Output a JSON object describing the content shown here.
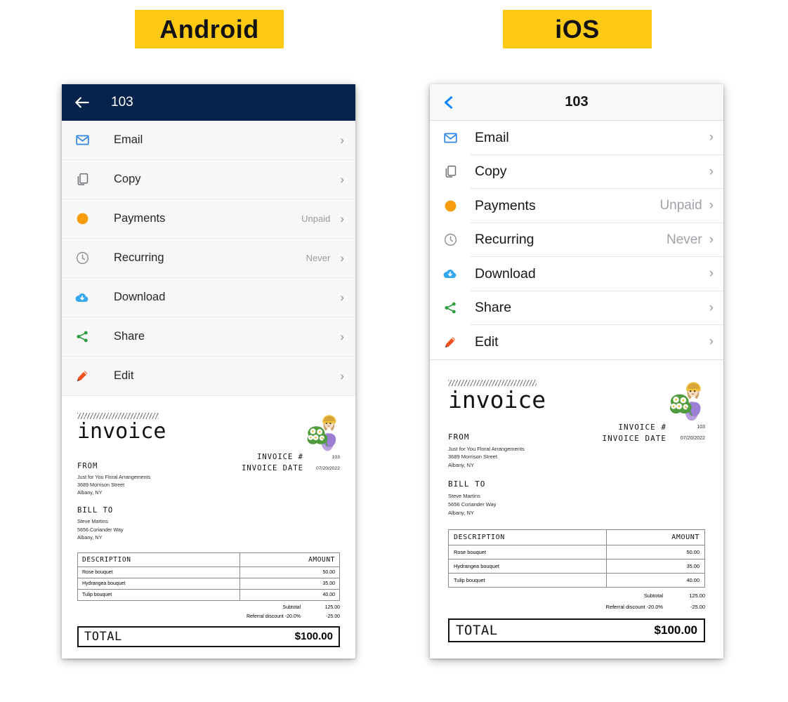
{
  "labels": {
    "android": "Android",
    "ios": "iOS",
    "chip_color": "#fdc913"
  },
  "android_screen": {
    "appbar": {
      "back_icon": "arrow-left-icon",
      "title": "103",
      "bg_color": "#04224b",
      "text_color": "#ffffff"
    },
    "menu": [
      {
        "icon": "envelope-icon",
        "icon_color": "#2f86e8",
        "label": "Email",
        "value": "",
        "chevron": "›"
      },
      {
        "icon": "copy-icon",
        "icon_color": "#6e6e75",
        "label": "Copy",
        "value": "",
        "chevron": "›"
      },
      {
        "icon": "dot-icon",
        "icon_color": "#f79c0c",
        "label": "Payments",
        "value": "Unpaid",
        "chevron": "›"
      },
      {
        "icon": "clock-icon",
        "icon_color": "#8c8c93",
        "label": "Recurring",
        "value": "Never",
        "chevron": "›"
      },
      {
        "icon": "cloud-download-icon",
        "icon_color": "#36a7ef",
        "label": "Download",
        "value": "",
        "chevron": "›"
      },
      {
        "icon": "share-icon",
        "icon_color": "#2f9e3f",
        "label": "Share",
        "value": "",
        "chevron": "›"
      },
      {
        "icon": "pencil-icon",
        "icon_color": "#f4511e",
        "label": "Edit",
        "value": "",
        "chevron": "›"
      }
    ]
  },
  "ios_screen": {
    "navbar": {
      "back_icon": "chevron-left-icon",
      "back_color": "#0a84ff",
      "title": "103",
      "bg_color": "#f8f8f8"
    },
    "menu": [
      {
        "icon": "envelope-icon",
        "icon_color": "#2f86e8",
        "label": "Email",
        "value": "",
        "chevron": "›"
      },
      {
        "icon": "copy-icon",
        "icon_color": "#6e6e75",
        "label": "Copy",
        "value": "",
        "chevron": "›"
      },
      {
        "icon": "dot-icon",
        "icon_color": "#f79c0c",
        "label": "Payments",
        "value": "Unpaid",
        "chevron": "›"
      },
      {
        "icon": "clock-icon",
        "icon_color": "#8c8c93",
        "label": "Recurring",
        "value": "Never",
        "chevron": "›"
      },
      {
        "icon": "cloud-download-icon",
        "icon_color": "#36a7ef",
        "label": "Download",
        "value": "",
        "chevron": "›"
      },
      {
        "icon": "share-icon",
        "icon_color": "#2f9e3f",
        "label": "Share",
        "value": "",
        "chevron": "›"
      },
      {
        "icon": "pencil-icon",
        "icon_color": "#f4511e",
        "label": "Edit",
        "value": "",
        "chevron": "›"
      }
    ]
  },
  "invoice": {
    "word": "invoice",
    "logo": "flower-girl-illustration",
    "from_label": "FROM",
    "from_lines": [
      "Just for You Floral Arrangements",
      "3689 Morrison Street",
      "Albany, NY"
    ],
    "bill_to_label": "BILL TO",
    "bill_to_lines": [
      "Steve Martins",
      "5656 Coriander Way",
      "Albany, NY"
    ],
    "meta": [
      {
        "key": "INVOICE #",
        "value": "103"
      },
      {
        "key": "INVOICE DATE",
        "value": "07/20/2022"
      }
    ],
    "table": {
      "headers": [
        "DESCRIPTION",
        "AMOUNT"
      ],
      "rows": [
        {
          "description": "Rose bouquet",
          "amount": "50.00"
        },
        {
          "description": "Hydrangea bouquet",
          "amount": "35.00"
        },
        {
          "description": "Tulip bouquet",
          "amount": "40.00"
        }
      ]
    },
    "totals": [
      {
        "key": "Subtotal",
        "value": "125.00"
      },
      {
        "key": "Referral discount -20.0%",
        "value": "-25.00"
      }
    ],
    "grand_total": {
      "key": "TOTAL",
      "value": "$100.00"
    }
  }
}
